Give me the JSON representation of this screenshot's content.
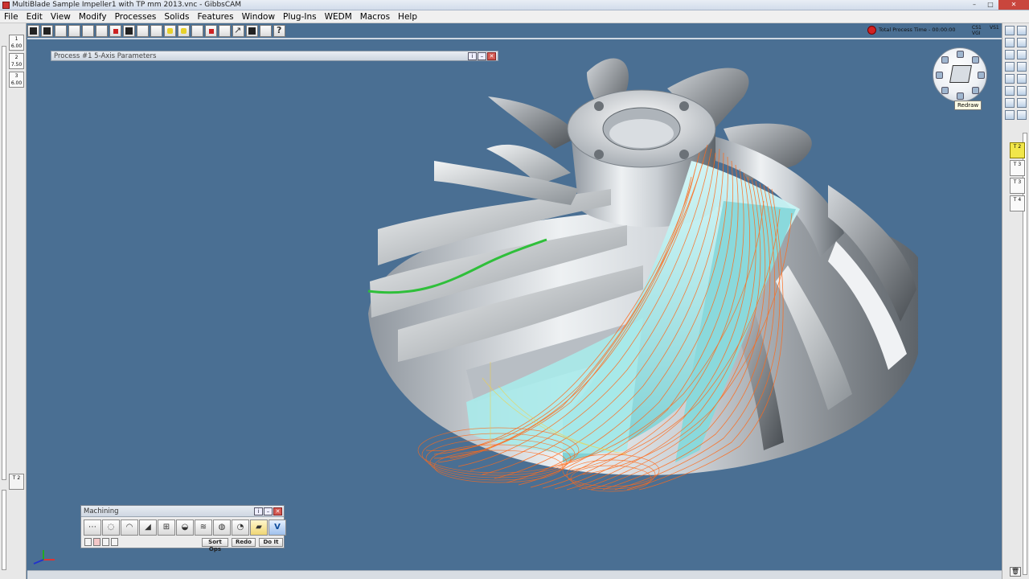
{
  "window": {
    "title": "MultiBlade Sample Impeller1 with TP mm 2013.vnc - GibbsCAM",
    "minimize": "–",
    "maximize": "□",
    "close": "✕"
  },
  "menu": [
    "File",
    "Edit",
    "View",
    "Modify",
    "Processes",
    "Solids",
    "Features",
    "Window",
    "Plug-Ins",
    "WEDM",
    "Macros",
    "Help"
  ],
  "left_tools": [
    {
      "label": "1",
      "value": "6.00"
    },
    {
      "label": "2",
      "value": "7.50"
    },
    {
      "label": "3",
      "value": "6.00"
    }
  ],
  "left_bottom_tool": {
    "label": "T 2"
  },
  "right_tools": [
    {
      "label": "T 2",
      "active": true
    },
    {
      "label": "T 3",
      "active": false
    },
    {
      "label": "T 3",
      "active": false
    },
    {
      "label": "T 4",
      "active": false
    }
  ],
  "process_time": {
    "label": "Total Process Time",
    "value": "00:00:00",
    "display": "Total Process Time - 00:00:00"
  },
  "cs": {
    "cs": "CS1",
    "vg": "VGI",
    "vs": "VS1"
  },
  "tooltip": "Redraw",
  "process_panel": {
    "title": "Process #1 5-Axis Parameters"
  },
  "machining_panel": {
    "title": "Machining",
    "buttons": [
      "⋯",
      "◌",
      "◠",
      "◢",
      "⊞",
      "◒",
      "≋",
      "◍",
      "◔",
      "▰",
      "V"
    ],
    "sort_label": "Sort Ops",
    "redo_label": "Redo",
    "doit_label": "Do It"
  },
  "colors": {
    "background": "#4a6f93",
    "toolpath": "#ff6a1a",
    "blade_highlight": "#9fe6e8",
    "profile_curve": "#2fbf3a",
    "stop": "#d32222"
  }
}
